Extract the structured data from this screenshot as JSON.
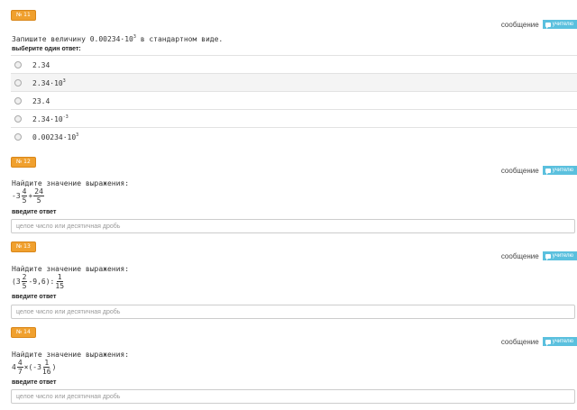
{
  "message_label": "сообщение",
  "teacher_label": "учителю",
  "q1": {
    "badge": "№ 11",
    "question": "Запишите величину 0.00234·10",
    "question_exp": "3",
    "question_tail": " в стандартном виде.",
    "hint": "выберите один ответ:",
    "options": [
      {
        "base": "2.34",
        "exp": ""
      },
      {
        "base": "2.34·10",
        "exp": "3"
      },
      {
        "base": "23.4",
        "exp": ""
      },
      {
        "base": "2.34·10",
        "exp": "-3"
      },
      {
        "base": "0.00234·10",
        "exp": "3"
      }
    ]
  },
  "q2": {
    "badge": "№ 12",
    "question": "Найдите значение выражения:",
    "expr": {
      "lead": "-3",
      "f1n": "4",
      "f1d": "5",
      "op": "+",
      "f2n": "24",
      "f2d": "5"
    },
    "hint": "введите ответ",
    "placeholder": "целое число или десятичная дробь"
  },
  "q3": {
    "badge": "№ 13",
    "question": "Найдите значение выражения:",
    "expr": {
      "open": "(3",
      "f1n": "2",
      "f1d": "5",
      "mid": "-9,6):",
      "f2n": "1",
      "f2d": "15"
    },
    "hint": "введите ответ",
    "placeholder": "целое число или десятичная дробь"
  },
  "q4": {
    "badge": "№ 14",
    "question": "Найдите значение выражения:",
    "expr": {
      "lead": "4",
      "f1n": "4",
      "f1d": "7",
      "mid": "×(-3",
      "f2n": "1",
      "f2d": "16",
      "close": ")"
    },
    "hint": "введите ответ",
    "placeholder": "целое число или десятичная дробь"
  }
}
